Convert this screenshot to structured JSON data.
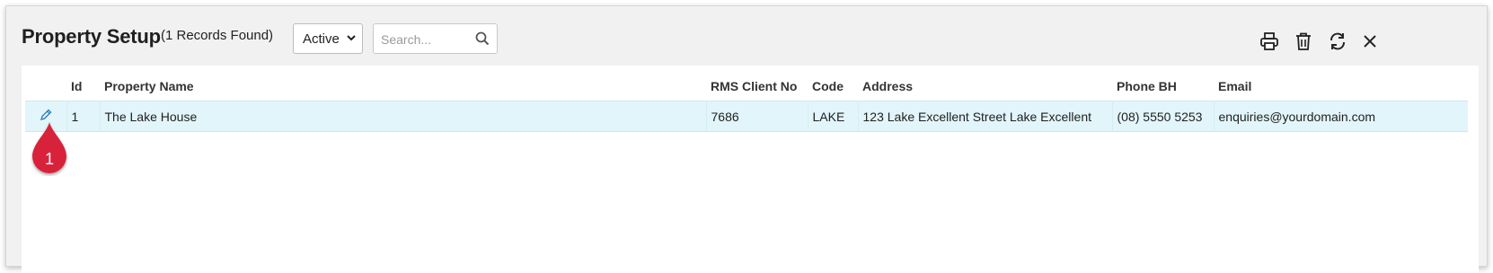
{
  "header": {
    "title": "Property Setup",
    "record_count": "(1 Records Found)",
    "status_filter": "Active",
    "search_placeholder": "Search..."
  },
  "toolbar": {
    "icons": [
      "printer-icon",
      "trash-icon",
      "refresh-icon",
      "close-icon"
    ]
  },
  "table": {
    "columns": [
      "Id",
      "Property Name",
      "RMS Client No",
      "Code",
      "Address",
      "Phone BH",
      "Email"
    ],
    "rows": [
      {
        "id": "1",
        "property_name": "The Lake House",
        "rms_client_no": "7686",
        "code": "LAKE",
        "address": "123 Lake Excellent Street Lake Excellent",
        "phone_bh": "(08) 5550 5253",
        "email": "enquiries@yourdomain.com"
      }
    ]
  },
  "callout": {
    "number": "1"
  },
  "colors": {
    "accent": "#2a7ab8",
    "row_highlight": "#e2f5fa",
    "callout_red": "#d8233a"
  }
}
